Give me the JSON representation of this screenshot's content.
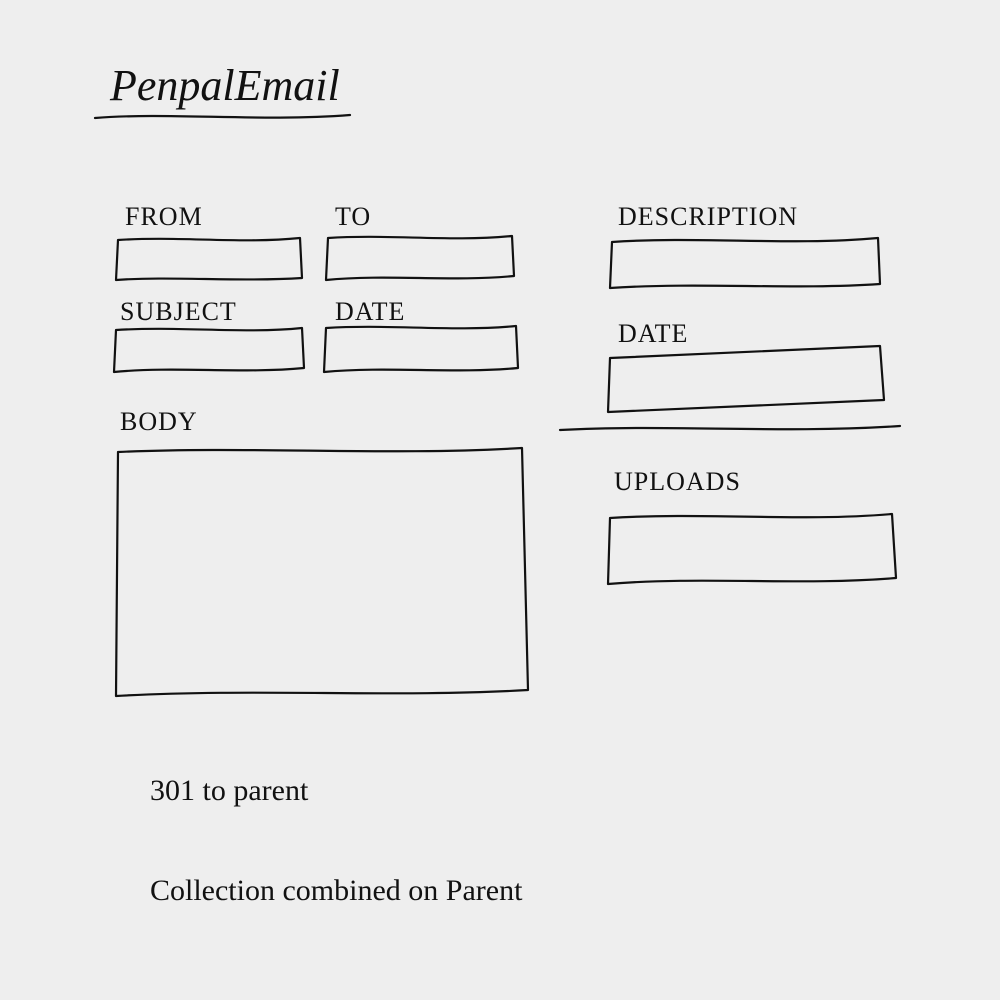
{
  "title": "PenpalEmail",
  "left": {
    "from": "FROM",
    "to": "TO",
    "subject": "SUBJECT",
    "date": "DATE",
    "body": "BODY"
  },
  "right": {
    "description": "DESCRIPTION",
    "date": "DATE",
    "uploads": "UPLOADS"
  },
  "notes": {
    "n1": "301 to parent",
    "n2": "Collection combined on Parent"
  }
}
